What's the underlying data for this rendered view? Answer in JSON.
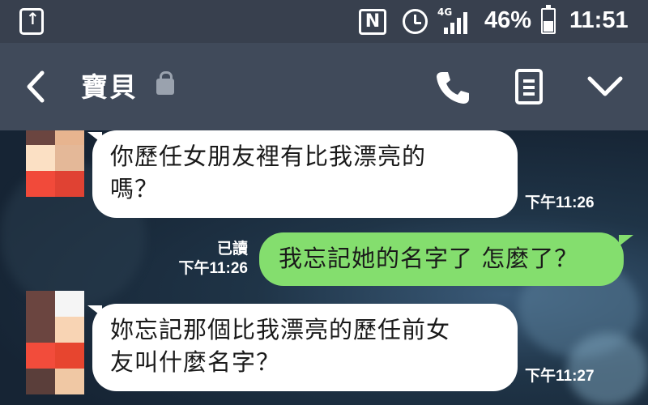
{
  "status_bar": {
    "network": "4G",
    "battery": "46%",
    "battery_level": 0.46,
    "time": "11:51",
    "nfc_label": "N",
    "icons": [
      "upload-icon",
      "nfc-icon",
      "alarm-icon",
      "signal-icon",
      "battery-icon"
    ]
  },
  "header": {
    "title": "寶貝",
    "icons": [
      "back-icon",
      "lock-icon",
      "phone-icon",
      "menu-icon",
      "chevron-down-icon"
    ]
  },
  "messages": [
    {
      "direction": "received",
      "lines": [
        "你歷任女朋友裡有比我漂亮的",
        "嗎？"
      ],
      "time": "下午11:26"
    },
    {
      "direction": "sent",
      "lines": [
        "我忘記她的名字了 怎麼了？"
      ],
      "read": "已讀",
      "time": "下午11:26"
    },
    {
      "direction": "received",
      "lines": [
        "妳忘記那個比我漂亮的歷任前女",
        "友叫什麼名字？"
      ],
      "time": "下午11:27"
    }
  ],
  "colors": {
    "status_bar": "#38404e",
    "header": "#404a5a",
    "sent_bubble": "#84de6e",
    "received_bubble": "#ffffff"
  }
}
